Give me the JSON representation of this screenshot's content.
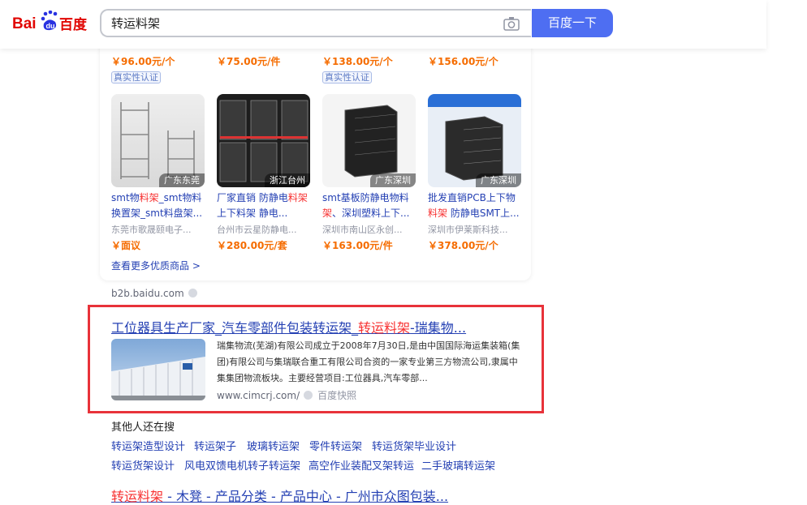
{
  "header": {
    "logo_text": "Bai du 百度",
    "search_value": "转运料架",
    "search_button": "百度一下",
    "camera_icon": "camera-icon"
  },
  "products_top": [
    {
      "price": "￥96.00元/个",
      "badge": "真实性认证"
    },
    {
      "price": "￥75.00元/件",
      "badge": ""
    },
    {
      "price": "￥138.00元/个",
      "badge": "真实性认证"
    },
    {
      "price": "￥156.00元/个",
      "badge": ""
    }
  ],
  "products": [
    {
      "location": "广东东莞",
      "title_pre": "smt物",
      "title_hl": "料架",
      "title_post": "_smt物料换置架_smt料盘架...",
      "shop": "东莞市歌晟颐电子...",
      "price": "￥面议"
    },
    {
      "location": "浙江台州",
      "title_pre": "厂家直销 防静电",
      "title_hl": "料架",
      "title_post": "上下料架 静电...",
      "shop": "台州市云星防静电...",
      "price": "￥280.00元/套"
    },
    {
      "location": "广东深圳",
      "title_pre": "smt基板防静电物料",
      "title_hl": "架",
      "title_post": "、深圳塑料上下...",
      "shop": "深圳市南山区永创...",
      "price": "￥163.00元/件"
    },
    {
      "location": "广东深圳",
      "title_pre": "批发直销PCB上下物",
      "title_hl": "料架",
      "title_post": " 防静电SMT上...",
      "shop": "深圳市伊莱斯科技...",
      "price": "￥378.00元/个"
    }
  ],
  "more_products": "查看更多优质商品 >",
  "source_domain": "b2b.baidu.com",
  "result": {
    "title_pre": "工位器具生产厂家_汽车零部件包装转运架_",
    "title_hl": "转运料架",
    "title_post": "-瑞集物...",
    "abstract": "瑞集物流(芜湖)有限公司成立于2008年7月30日,是由中国国际海运集装箱(集团)有限公司与集瑞联合重工有限公司合资的一家专业第三方物流公司,隶属中集集团物流板块。主要经营项目:工位器具,汽车零部...",
    "url": "www.cimcrj.com/",
    "snapshot": "百度快照"
  },
  "related": {
    "title": "其他人还在搜",
    "row1": [
      "转运架造型设计",
      "转运架子",
      "玻璃转运架",
      "零件转运架",
      "转运货架毕业设计"
    ],
    "row2": [
      "转运货架设计",
      "风电双馈电机转子转运架",
      "高空作业装配叉架转运",
      "二手玻璃转运架"
    ]
  },
  "next_result": {
    "title_hl": "转运料架",
    "title_post": " - 木凳 - 产品分类 - 产品中心 - 广州市众图包装..."
  },
  "colors": {
    "accent": "#4e6ef2",
    "link": "#2440b3",
    "highlight": "#f73131",
    "price": "#f56c00",
    "red_box": "#e8323a"
  }
}
